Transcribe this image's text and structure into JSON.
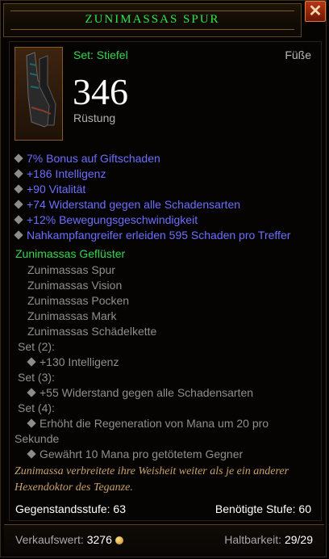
{
  "header": {
    "title": "ZUNIMASSAS SPUR",
    "close_glyph": "✕"
  },
  "item": {
    "type": "Set: Stiefel",
    "slot": "Füße",
    "armor_value": "346",
    "armor_label": "Rüstung",
    "icon": "boots-icon"
  },
  "affixes": [
    "7% Bonus auf Giftschaden",
    "+186 Intelligenz",
    "+90 Vitalität",
    "+74 Widerstand gegen alle Schadensarten",
    "+12% Bewegungsgeschwindigkeit",
    "Nahkampfangreifer erleiden 595 Schaden pro Treffer"
  ],
  "set": {
    "name": "Zunimassas Geflüster",
    "pieces": [
      "Zunimassas Spur",
      "Zunimassas Vision",
      "Zunimassas Pocken",
      "Zunimassas Mark",
      "Zunimassas Schädelkette"
    ],
    "bonus_2_label": "Set (2):",
    "bonus_2": "+130 Intelligenz",
    "bonus_3_label": "Set (3):",
    "bonus_3": "+55 Widerstand gegen alle Schadensarten",
    "bonus_4_label": "Set (4):",
    "bonus_4a_line1": "Erhöht die Regeneration von Mana um 20 pro",
    "bonus_4a_line2": "Sekunde",
    "bonus_4b": "Gewährt 10 Mana pro getötetem Gegner"
  },
  "flavor": "Zunimassa verbreitete ihre Weisheit weiter als je ein anderer Hexendoktor des Teganze.",
  "levels": {
    "item_level": "Gegenstandsstufe: 63",
    "required_level": "Benötigte Stufe: 60"
  },
  "footer": {
    "sell_label": "Verkaufswert:",
    "sell_value": "3276",
    "durability_label": "Haltbarkeit:",
    "durability_value": "29/29"
  },
  "colors": {
    "title": "#2ee64a",
    "set_green": "#33d84c",
    "affix_blue": "#6d6dff",
    "flavor": "#c8a26a"
  }
}
